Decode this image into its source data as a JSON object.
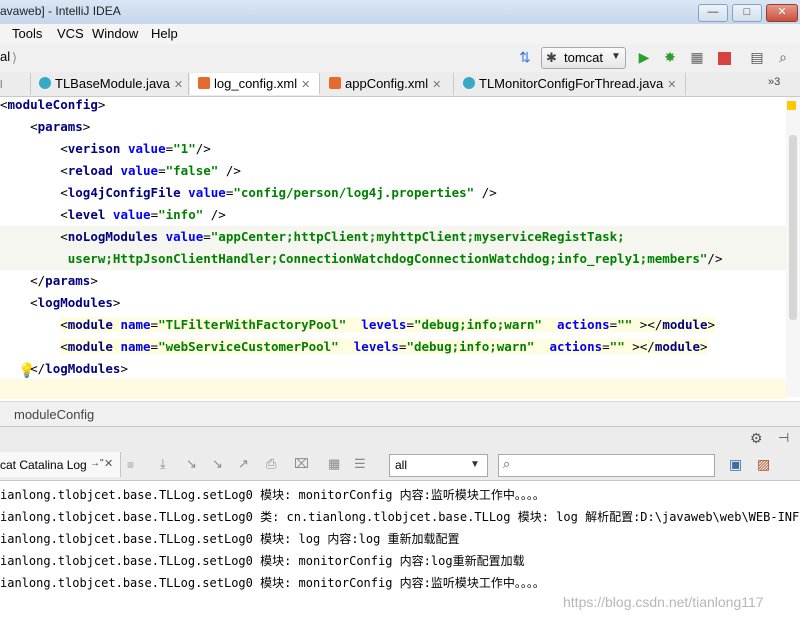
{
  "window": {
    "title": "avaweb] - IntelliJ IDEA",
    "buttons": {
      "minimize": "—",
      "maximize": "□",
      "close": "✕"
    }
  },
  "menu": [
    "Tools",
    "VCS",
    "Window",
    "Help"
  ],
  "toolbar": {
    "left_fragment": "al",
    "run_config": "tomcat",
    "icons": [
      "sort-icon",
      "tomcat-icon",
      "run-icon",
      "debug-icon",
      "coverage-icon",
      "stop-icon",
      "structure-icon",
      "search-icon"
    ]
  },
  "tabs": [
    {
      "label": "TLBaseModule.java",
      "icon": "class-icon",
      "active": false
    },
    {
      "label": "log_config.xml",
      "icon": "xml-icon",
      "active": true
    },
    {
      "label": "appConfig.xml",
      "icon": "xml-icon",
      "active": false
    },
    {
      "label": "TLMonitorConfigForThread.java",
      "icon": "class-icon",
      "active": false
    }
  ],
  "tab_overflow": "»3",
  "editor": {
    "lines": [
      {
        "indent": "",
        "tokens": [
          [
            "t",
            "<"
          ],
          [
            "tag",
            "moduleConfig"
          ],
          [
            "t",
            ">"
          ]
        ]
      },
      {
        "indent": "    ",
        "tokens": [
          [
            "t",
            "<"
          ],
          [
            "tag",
            "params"
          ],
          [
            "t",
            ">"
          ]
        ]
      },
      {
        "indent": "        ",
        "tokens": [
          [
            "t",
            "<"
          ],
          [
            "tag",
            "verison"
          ],
          [
            "t",
            " "
          ],
          [
            "attr",
            "value"
          ],
          [
            "t",
            "="
          ],
          [
            "str",
            "\"1\""
          ],
          [
            "t",
            "/>"
          ]
        ]
      },
      {
        "indent": "        ",
        "tokens": [
          [
            "t",
            "<"
          ],
          [
            "tag",
            "reload"
          ],
          [
            "t",
            " "
          ],
          [
            "attr",
            "value"
          ],
          [
            "t",
            "="
          ],
          [
            "str",
            "\"false\""
          ],
          [
            "t",
            " />"
          ]
        ]
      },
      {
        "indent": "        ",
        "tokens": [
          [
            "t",
            "<"
          ],
          [
            "tag",
            "log4jConfigFile"
          ],
          [
            "t",
            " "
          ],
          [
            "attr",
            "value"
          ],
          [
            "t",
            "="
          ],
          [
            "str",
            "\"config/person/log4j.properties\""
          ],
          [
            "t",
            " />"
          ]
        ]
      },
      {
        "indent": "        ",
        "tokens": [
          [
            "t",
            "<"
          ],
          [
            "tag",
            "level"
          ],
          [
            "t",
            " "
          ],
          [
            "attr",
            "value"
          ],
          [
            "t",
            "="
          ],
          [
            "str",
            "\"info\""
          ],
          [
            "t",
            " />"
          ]
        ]
      },
      {
        "indent": "        ",
        "tokens": [
          [
            "t",
            "<"
          ],
          [
            "tag",
            "noLogModules"
          ],
          [
            "t",
            " "
          ],
          [
            "attr",
            "value"
          ],
          [
            "t",
            "="
          ],
          [
            "str",
            "\"appCenter;httpClient;myhttpClient;myserviceRegistTask;"
          ]
        ]
      },
      {
        "indent": "         ",
        "tokens": [
          [
            "str",
            "userw;HttpJsonClientHandler;ConnectionWatchdogConnectionWatchdog;info_reply1;members\""
          ],
          [
            "t",
            "/>"
          ]
        ]
      },
      {
        "indent": "    ",
        "tokens": [
          [
            "t",
            "</"
          ],
          [
            "tag",
            "params"
          ],
          [
            "t",
            ">"
          ]
        ]
      },
      {
        "indent": "    ",
        "tokens": [
          [
            "t",
            "<"
          ],
          [
            "tag",
            "logModules"
          ],
          [
            "t",
            ">"
          ]
        ]
      },
      {
        "indent": "        ",
        "tokens": [
          [
            "t",
            "<"
          ],
          [
            "tag",
            "module"
          ],
          [
            "t",
            " "
          ],
          [
            "attr",
            "name"
          ],
          [
            "t",
            "="
          ],
          [
            "str",
            "\"TLFilterWithFactoryPool\""
          ],
          [
            "t",
            "  "
          ],
          [
            "attr",
            "levels"
          ],
          [
            "t",
            "="
          ],
          [
            "str",
            "\"debug;info;warn\""
          ],
          [
            "t",
            "  "
          ],
          [
            "attr",
            "actions"
          ],
          [
            "t",
            "="
          ],
          [
            "str",
            "\"\""
          ],
          [
            "t",
            " ></"
          ],
          [
            "tag",
            "module"
          ],
          [
            "t",
            ">"
          ]
        ]
      },
      {
        "indent": "        ",
        "tokens": [
          [
            "t",
            "<"
          ],
          [
            "tag",
            "module"
          ],
          [
            "t",
            " "
          ],
          [
            "attr",
            "name"
          ],
          [
            "t",
            "="
          ],
          [
            "str",
            "\"webServiceCustomerPool\""
          ],
          [
            "t",
            "  "
          ],
          [
            "attr",
            "levels"
          ],
          [
            "t",
            "="
          ],
          [
            "str",
            "\"debug;info;warn\""
          ],
          [
            "t",
            "  "
          ],
          [
            "attr",
            "actions"
          ],
          [
            "t",
            "="
          ],
          [
            "str",
            "\"\""
          ],
          [
            "t",
            " ></"
          ],
          [
            "tag",
            "module"
          ],
          [
            "t",
            ">"
          ]
        ]
      },
      {
        "indent": "    ",
        "tokens": [
          [
            "t",
            "</"
          ],
          [
            "tag",
            "logModules"
          ],
          [
            "t",
            ">"
          ]
        ]
      }
    ]
  },
  "breadcrumb": "moduleConfig",
  "run_panel": {
    "tab_label": "cat Catalina Log",
    "tab_pin": "→\"",
    "filter_value": "all",
    "search_placeholder": ""
  },
  "console_lines": [
    "ianlong.tlobjcet.base.TLLog.setLog0 模块: monitorConfig 内容:监听模块工作中。。。。",
    "ianlong.tlobjcet.base.TLLog.setLog0 类: cn.tianlong.tlobjcet.base.TLLog 模块: log 解析配置:D:\\javaweb\\web\\WEB-INF\\q",
    "ianlong.tlobjcet.base.TLLog.setLog0 模块: log 内容:log 重新加载配置",
    "ianlong.tlobjcet.base.TLLog.setLog0 模块: monitorConfig 内容:log重新配置加载",
    "ianlong.tlobjcet.base.TLLog.setLog0 模块: monitorConfig 内容:监听模块工作中。。。。"
  ],
  "watermark": "https://blog.csdn.net/tianlong117",
  "colors": {
    "tag": "#000080",
    "attr": "#0000ff",
    "string": "#008000",
    "run": "#2aa12a",
    "stop": "#d64141"
  }
}
